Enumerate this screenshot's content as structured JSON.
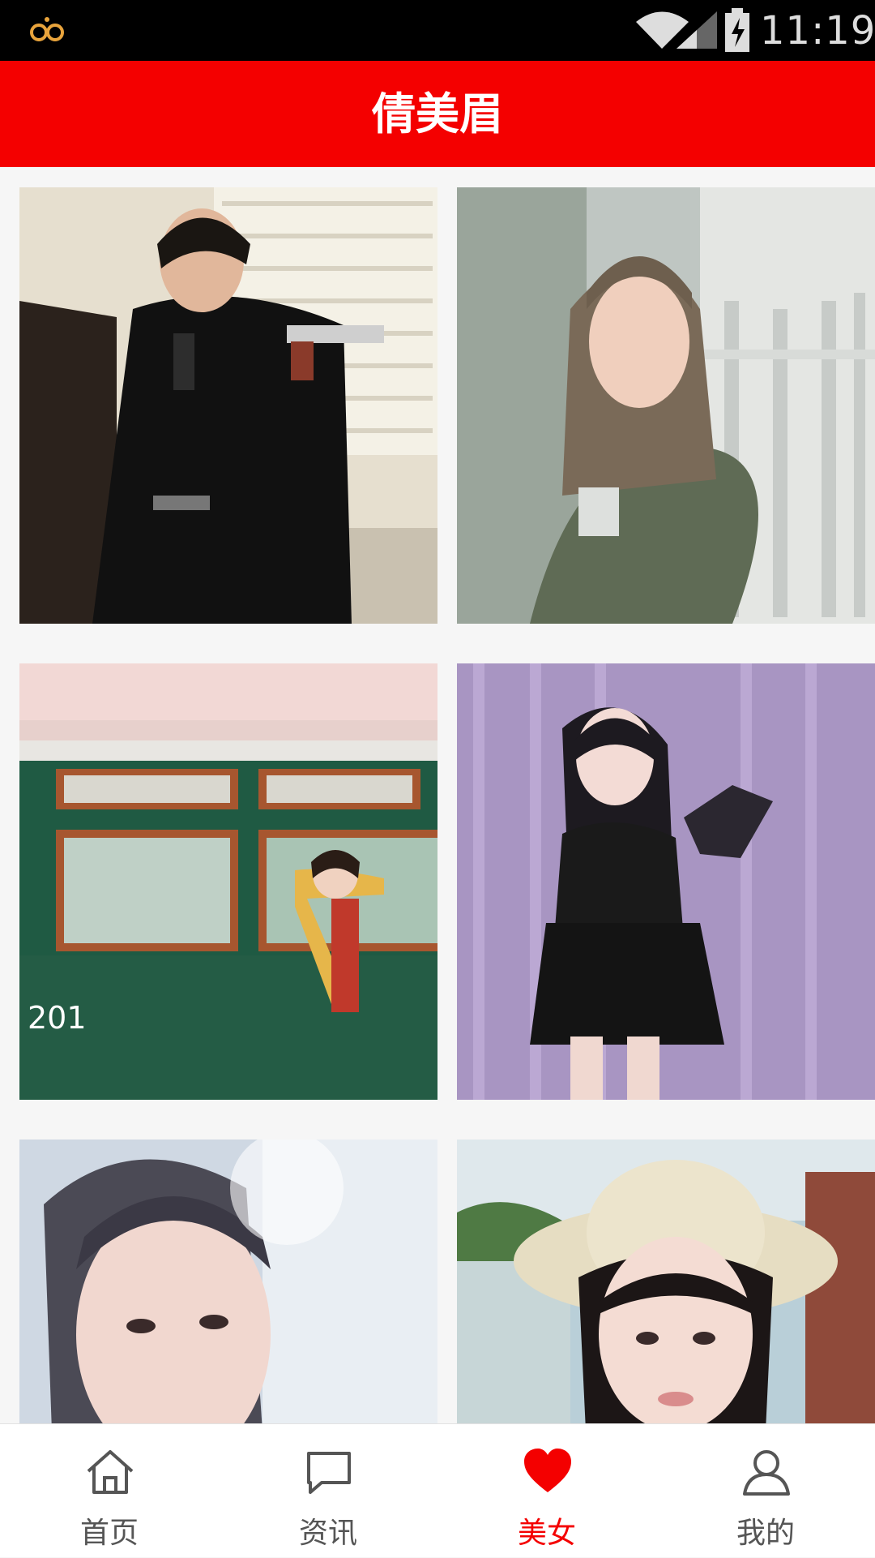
{
  "status_bar": {
    "time": "11:19",
    "icons": [
      "infinity-notification-icon",
      "wifi-icon",
      "signal-icon",
      "battery-charging-icon"
    ]
  },
  "app_bar": {
    "title": "倩美眉",
    "background_color": "#f40000"
  },
  "gallery": {
    "photos": [
      {
        "description_icon": "photo-1"
      },
      {
        "description_icon": "photo-2"
      },
      {
        "description_icon": "photo-3"
      },
      {
        "description_icon": "photo-4"
      },
      {
        "description_icon": "photo-5"
      },
      {
        "description_icon": "photo-6"
      }
    ]
  },
  "tab_bar": {
    "active_color": "#f40000",
    "items": [
      {
        "label": "首页",
        "icon": "home-icon",
        "active": false
      },
      {
        "label": "资讯",
        "icon": "chat-bubble-icon",
        "active": false
      },
      {
        "label": "美女",
        "icon": "heart-icon",
        "active": true
      },
      {
        "label": "我的",
        "icon": "user-icon",
        "active": false
      }
    ]
  }
}
